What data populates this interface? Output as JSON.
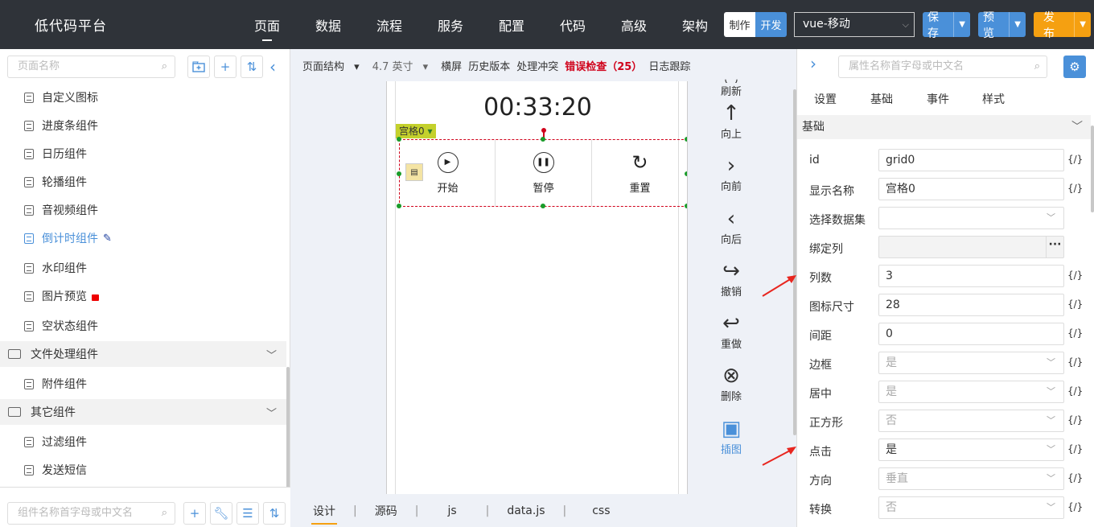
{
  "app": {
    "title": "低代码平台"
  },
  "nav": [
    "页面",
    "数据",
    "流程",
    "服务",
    "配置",
    "代码",
    "高级",
    "架构"
  ],
  "mode": {
    "make": "制作",
    "dev": "开发"
  },
  "platform": "vue-移动",
  "actions": {
    "save": "保存",
    "preview": "预览",
    "publish": "发布"
  },
  "left": {
    "page_search_placeholder": "页面名称",
    "tree": [
      {
        "label": "自定义图标"
      },
      {
        "label": "进度条组件"
      },
      {
        "label": "日历组件"
      },
      {
        "label": "轮播组件"
      },
      {
        "label": "音视频组件"
      },
      {
        "label": "倒计时组件"
      },
      {
        "label": "水印组件"
      },
      {
        "label": "图片预览"
      },
      {
        "label": "空状态组件"
      },
      {
        "label": "文件处理组件"
      },
      {
        "label": "附件组件"
      },
      {
        "label": "其它组件"
      },
      {
        "label": "过滤组件"
      },
      {
        "label": "发送短信"
      }
    ],
    "comp_search_placeholder": "组件名称首字母或中文名"
  },
  "toolbar": {
    "structure": "页面结构",
    "size": "4.7 英寸",
    "landscape": "横屏",
    "history": "历史版本",
    "conflict": "处理冲突",
    "errors": "错误检查（25）",
    "log": "日志跟踪"
  },
  "canvas": {
    "timer": "00:33:20",
    "grid_tag": "宫格0",
    "cells": [
      {
        "label": "开始",
        "icon": "play-icon"
      },
      {
        "label": "暂停",
        "icon": "pause-icon"
      },
      {
        "label": "重置",
        "icon": "reset-icon"
      }
    ]
  },
  "tools": [
    {
      "label": "刷新",
      "icon": "refresh-icon"
    },
    {
      "label": "向上",
      "icon": "arrow-up-icon"
    },
    {
      "label": "向前",
      "icon": "chevron-right-icon"
    },
    {
      "label": "向后",
      "icon": "chevron-left-icon"
    },
    {
      "label": "撤销",
      "icon": "undo-icon"
    },
    {
      "label": "重做",
      "icon": "redo-icon"
    },
    {
      "label": "删除",
      "icon": "delete-icon"
    },
    {
      "label": "插图",
      "icon": "image-icon"
    }
  ],
  "bottom_tabs": [
    "设计",
    "源码",
    "js",
    "data.js",
    "css"
  ],
  "right": {
    "search_placeholder": "属性名称首字母或中文名",
    "tabs": [
      "设置",
      "基础",
      "事件",
      "样式"
    ],
    "section": "基础",
    "fx_label": "{/}",
    "props": [
      {
        "label": "id",
        "value": "grid0"
      },
      {
        "label": "显示名称",
        "value": "宫格0"
      },
      {
        "label": "选择数据集",
        "value": ""
      },
      {
        "label": "绑定列",
        "value": ""
      },
      {
        "label": "列数",
        "value": "3"
      },
      {
        "label": "图标尺寸",
        "value": "28"
      },
      {
        "label": "间距",
        "value": "0"
      },
      {
        "label": "边框",
        "value": "是"
      },
      {
        "label": "居中",
        "value": "是"
      },
      {
        "label": "正方形",
        "value": "否"
      },
      {
        "label": "点击",
        "value": "是"
      },
      {
        "label": "方向",
        "value": "垂直"
      },
      {
        "label": "转换",
        "value": "否"
      }
    ]
  },
  "colors": {
    "accent": "#4a90d9",
    "topbar": "#2f3339",
    "publish": "#f5a011",
    "error": "#d0021b"
  }
}
